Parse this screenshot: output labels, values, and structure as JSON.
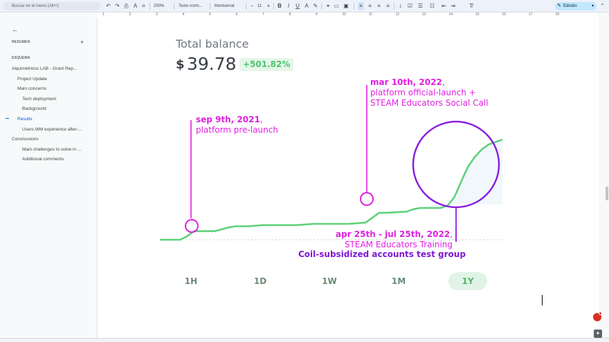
{
  "toolbar": {
    "menu_search_placeholder": "Buscar en el menú (Alt+/)",
    "zoom": "200%",
    "style": "Texto norm...",
    "font": "Montserrat",
    "font_size": "11",
    "mode": "Edición"
  },
  "ruler": {
    "numbers": [
      "1",
      "2",
      "3",
      "4",
      "5",
      "6",
      "7",
      "8",
      "9",
      "10",
      "11",
      "12",
      "13",
      "14",
      "15",
      "16",
      "17",
      "18"
    ]
  },
  "sidebar": {
    "summary_heading": "RESUMEN",
    "outline_heading": "ESQUEMA",
    "items": [
      {
        "label": "Alquimétricos LAB - Grant Rep...",
        "level": 0
      },
      {
        "label": "Project Update",
        "level": 1
      },
      {
        "label": "Main concerns",
        "level": 1
      },
      {
        "label": "Tech deployment",
        "level": 2
      },
      {
        "label": "Background",
        "level": 2
      },
      {
        "label": "Results",
        "level": 1
      },
      {
        "label": "Users WM experience after-...",
        "level": 2
      },
      {
        "label": "Conclussions",
        "level": 0
      },
      {
        "label": "Main challenges to solve in ...",
        "level": 2
      },
      {
        "label": "Additional comments",
        "level": 2
      }
    ]
  },
  "doc": {
    "total_title": "Total balance",
    "currency": "$",
    "amount": "39.78",
    "change": "+501.82%",
    "annotations": {
      "a1_date": "sep 9th, 2021",
      "a1_comma": ",",
      "a1_text": "platform pre-launch",
      "a2_date": "mar 10th, 2022",
      "a2_comma": ",",
      "a2_text1": "platform official-launch +",
      "a2_text2": "STEAM Educators Social Call",
      "a3_date": "apr 25th - jul 25th, 2022",
      "a3_comma": ",",
      "a3_text": "STEAM Educators Training",
      "a3_group": "Coil-subsidized accounts test group"
    },
    "ranges": [
      "1H",
      "1D",
      "1W",
      "1M",
      "1Y"
    ],
    "selected_range": "1Y"
  },
  "colors": {
    "line": "#5fd17a",
    "highlight_magenta": "#e020e0",
    "highlight_purple": "#8a1fe0"
  },
  "chart_data": {
    "type": "line",
    "series": [
      {
        "x": [
          0,
          6,
          8,
          10,
          14,
          16,
          20,
          22,
          26,
          30,
          40,
          45,
          55,
          60,
          62,
          64,
          66,
          72,
          74,
          76,
          78,
          82,
          84,
          86,
          88,
          90,
          92,
          94,
          96,
          98,
          100
        ],
        "values": [
          0,
          0,
          3,
          7,
          7,
          7,
          10,
          11,
          11,
          12,
          12,
          13,
          13,
          14,
          18,
          22,
          22,
          23,
          25,
          26,
          26,
          26,
          28,
          35,
          48,
          60,
          68,
          74,
          78,
          80,
          82
        ]
      }
    ]
  }
}
